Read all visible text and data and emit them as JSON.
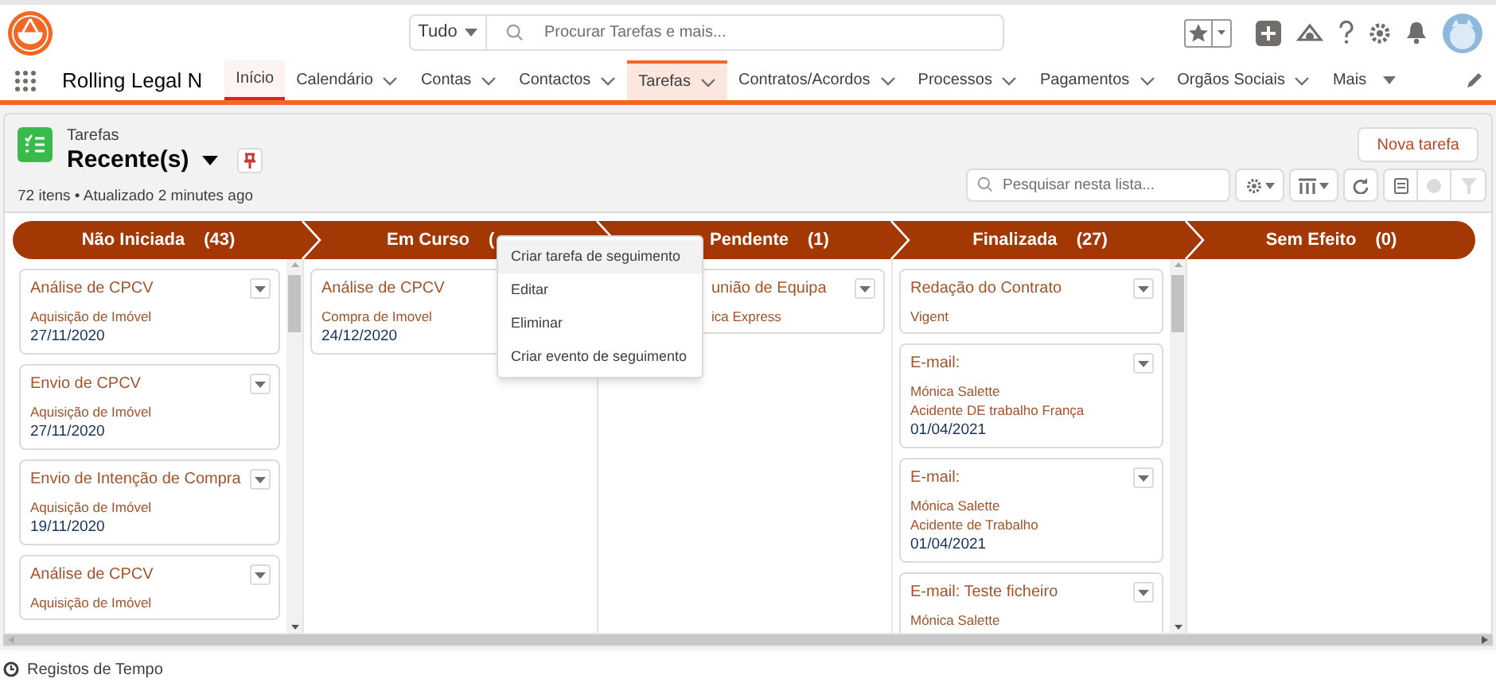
{
  "app": {
    "name": "Rolling Legal N"
  },
  "search": {
    "scope": "Tudo",
    "placeholder": "Procurar Tarefas e mais..."
  },
  "nav_tabs": [
    {
      "label": "Início",
      "kind": "plain",
      "selected": false
    },
    {
      "label": "Calendário",
      "kind": "dropdown",
      "selected": false
    },
    {
      "label": "Contas",
      "kind": "dropdown",
      "selected": false
    },
    {
      "label": "Contactos",
      "kind": "dropdown",
      "selected": false
    },
    {
      "label": "Tarefas",
      "kind": "dropdown",
      "selected": true
    },
    {
      "label": "Contratos/Acordos",
      "kind": "dropdown",
      "selected": false
    },
    {
      "label": "Processos",
      "kind": "dropdown",
      "selected": false
    },
    {
      "label": "Pagamentos",
      "kind": "dropdown",
      "selected": false
    },
    {
      "label": "Orgãos Sociais",
      "kind": "dropdown",
      "selected": false
    },
    {
      "label": "Mais",
      "kind": "more",
      "selected": false
    }
  ],
  "list_header": {
    "object": "Tarefas",
    "view": "Recente(s)",
    "status": "72 itens • Atualizado 2 minutes ago",
    "new_button": "Nova tarefa",
    "search_placeholder": "Pesquisar nesta lista..."
  },
  "kanban": [
    {
      "title": "Não Iniciada",
      "count": "(43)",
      "cards": [
        {
          "title": "Análise de CPCV",
          "lines": [
            {
              "text": "Aquisição de Imóvel",
              "kind": "link"
            },
            {
              "text": "27/11/2020",
              "kind": "date"
            }
          ]
        },
        {
          "title": "Envio de CPCV",
          "lines": [
            {
              "text": "Aquisição de Imóvel",
              "kind": "link"
            },
            {
              "text": "27/11/2020",
              "kind": "date"
            }
          ]
        },
        {
          "title": "Envio de Intenção de Compra",
          "lines": [
            {
              "text": "Aquisição de Imóvel",
              "kind": "link"
            },
            {
              "text": "19/11/2020",
              "kind": "date"
            }
          ]
        },
        {
          "title": "Análise de CPCV",
          "lines": [
            {
              "text": "Aquisição de Imóvel",
              "kind": "link"
            }
          ]
        }
      ]
    },
    {
      "title": "Em Curso",
      "count": "(",
      "cards": [
        {
          "title": "Análise de CPCV",
          "lines": [
            {
              "text": "Compra de Imovel",
              "kind": "link"
            },
            {
              "text": "24/12/2020",
              "kind": "date"
            }
          ]
        }
      ]
    },
    {
      "title": "Pendente",
      "count": "(1)",
      "cards": [
        {
          "title": "união de Equipa",
          "lines": [
            {
              "text": "ica Express",
              "kind": "link"
            }
          ]
        }
      ]
    },
    {
      "title": "Finalizada",
      "count": "(27)",
      "cards": [
        {
          "title": "Redação do Contrato",
          "lines": [
            {
              "text": "Vigent",
              "kind": "link"
            }
          ]
        },
        {
          "title": "E-mail:",
          "lines": [
            {
              "text": "Mónica Salette",
              "kind": "link"
            },
            {
              "text": "Acidente DE trabalho França",
              "kind": "link"
            },
            {
              "text": "01/04/2021",
              "kind": "date"
            }
          ]
        },
        {
          "title": "E-mail:",
          "lines": [
            {
              "text": "Mónica Salette",
              "kind": "link"
            },
            {
              "text": "Acidente de Trabalho",
              "kind": "link"
            },
            {
              "text": "01/04/2021",
              "kind": "date"
            }
          ]
        },
        {
          "title": "E-mail: Teste ficheiro",
          "lines": [
            {
              "text": "Mónica Salette",
              "kind": "link"
            }
          ]
        }
      ]
    },
    {
      "title": "Sem Efeito",
      "count": "(0)"
    }
  ],
  "context_menu": [
    {
      "label": "Criar tarefa de seguimento",
      "highlighted": true
    },
    {
      "label": "Editar",
      "highlighted": false
    },
    {
      "label": "Eliminar",
      "highlighted": false
    },
    {
      "label": "Criar evento de seguimento",
      "highlighted": false
    }
  ],
  "footer": {
    "label": "Registos de Tempo"
  }
}
